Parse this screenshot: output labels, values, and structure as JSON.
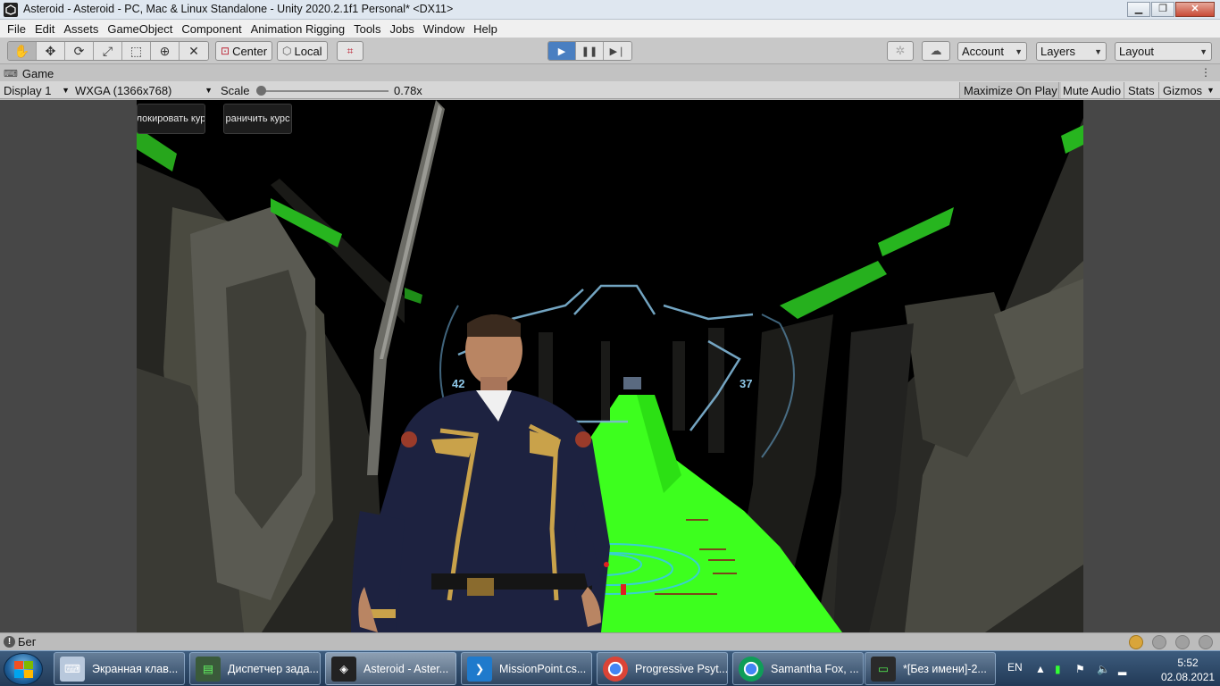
{
  "window": {
    "title": "Asteroid - Asteroid - PC, Mac & Linux Standalone - Unity 2020.2.1f1 Personal* <DX11>",
    "controls": {
      "minimize": "▁",
      "maximize": "❐",
      "close": "✕"
    }
  },
  "menu": [
    "File",
    "Edit",
    "Assets",
    "GameObject",
    "Component",
    "Animation Rigging",
    "Tools",
    "Jobs",
    "Window",
    "Help"
  ],
  "toolbar": {
    "tools": [
      "hand-tool-icon",
      "move-tool-icon",
      "rotate-tool-icon",
      "scale-tool-icon",
      "rect-tool-icon",
      "transform-tool-icon",
      "custom-tool-icon"
    ],
    "pivot_label": "Center",
    "space_label": "Local",
    "account_label": "Account",
    "layers_label": "Layers",
    "layout_label": "Layout"
  },
  "game_tab": {
    "label": "Game",
    "display": "Display 1",
    "resolution": "WXGA (1366x768)",
    "scale_label": "Scale",
    "scale_value": "0.78x",
    "scale_fraction": 0.05,
    "maximize_on_play": "Maximize On Play",
    "mute_audio": "Mute Audio",
    "stats": "Stats",
    "gizmos": "Gizmos"
  },
  "game_view": {
    "button_left": "локировать кур",
    "button_right": "раничить курс",
    "hud_left_value": "42",
    "hud_right_value": "37"
  },
  "status": {
    "message": "Бег"
  },
  "taskbar": {
    "tasks": [
      {
        "label": "Экранная клав...",
        "icon": "keyboard-icon"
      },
      {
        "label": "Диспетчер зада...",
        "icon": "task-manager-icon"
      },
      {
        "label": "Asteroid - Aster...",
        "icon": "unity-icon"
      },
      {
        "label": "MissionPoint.cs...",
        "icon": "vscode-icon"
      },
      {
        "label": "Progressive Psyt...",
        "icon": "chrome-icon"
      },
      {
        "label": "Samantha Fox, ...",
        "icon": "chrome-icon"
      },
      {
        "label": "*[Без имени]-2...",
        "icon": "paint-icon"
      }
    ],
    "language": "EN",
    "time": "5:52",
    "date": "02.08.2021"
  }
}
